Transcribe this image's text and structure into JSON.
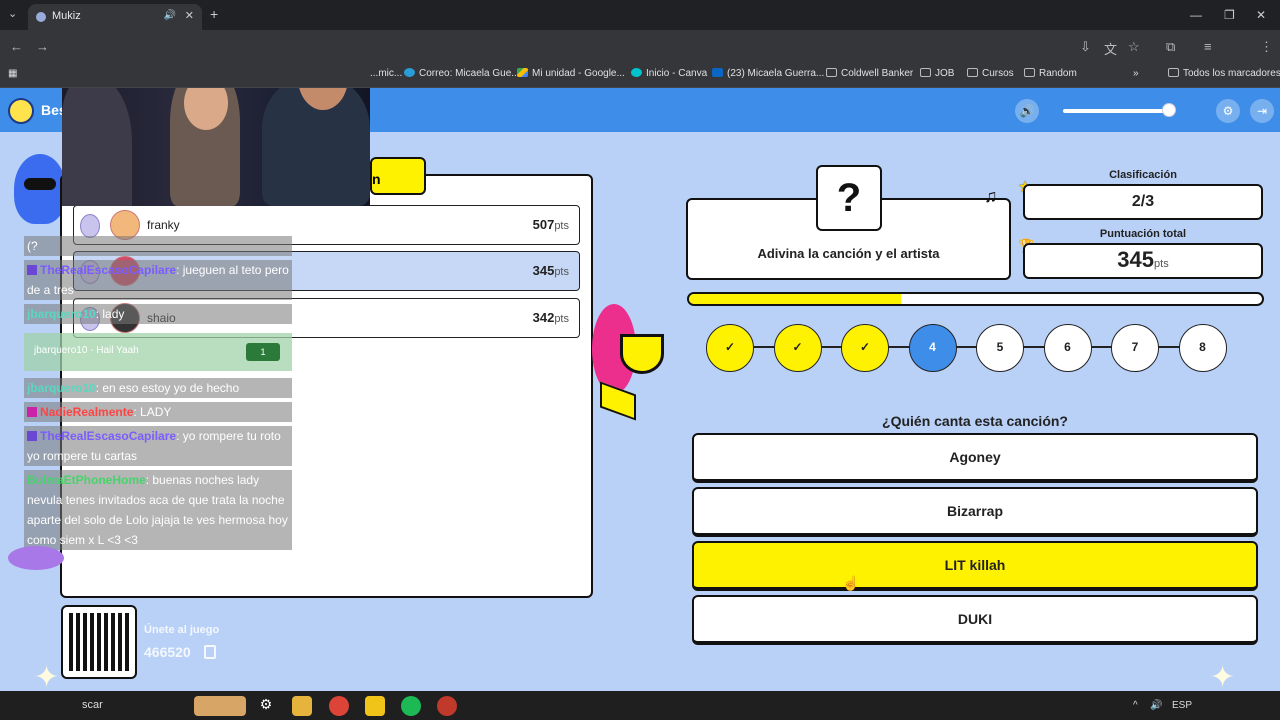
{
  "browser": {
    "tab_title": "Mukiz",
    "new_tab_label": "+",
    "bookmarks": [
      {
        "label": "...mic...",
        "icon": "folder-icon"
      },
      {
        "label": "Correo: Micaela Gue...",
        "icon": "outlook-icon"
      },
      {
        "label": "Mi unidad - Google...",
        "icon": "drive-icon"
      },
      {
        "label": "Inicio - Canva",
        "icon": "canva-icon"
      },
      {
        "label": "(23) Micaela Guerra...",
        "icon": "linkedin-icon"
      },
      {
        "label": "Coldwell Banker",
        "icon": "folder-icon"
      },
      {
        "label": "JOB",
        "icon": "folder-icon"
      },
      {
        "label": "Cursos",
        "icon": "folder-icon"
      },
      {
        "label": "Random",
        "icon": "folder-icon"
      }
    ],
    "bookmarks_overflow": "»",
    "all_bookmarks": "Todos los marcadores"
  },
  "game": {
    "brand": "Bes",
    "prompt": "Adivina la canción y el artista",
    "mystery_mark": "?",
    "ranking_label": "Clasificación",
    "ranking_value": "2/3",
    "total_label": "Puntuación total",
    "total_value": "345",
    "pts_unit": "pts",
    "progress": 0.37,
    "board_tag": "n",
    "steps": [
      {
        "label": "✓",
        "state": "done"
      },
      {
        "label": "✓",
        "state": "done"
      },
      {
        "label": "✓",
        "state": "done"
      },
      {
        "label": "4",
        "state": "current"
      },
      {
        "label": "5",
        "state": "todo"
      },
      {
        "label": "6",
        "state": "todo"
      },
      {
        "label": "7",
        "state": "todo"
      },
      {
        "label": "8",
        "state": "todo"
      }
    ],
    "question": "¿Quién canta esta canción?",
    "options": [
      "Agoney",
      "Bizarrap",
      "LIT killah",
      "DUKI"
    ],
    "selected_option": 2,
    "leaderboard": [
      {
        "name": "franky",
        "points": "507",
        "unit": "pts"
      },
      {
        "name": "",
        "points": "345",
        "unit": "pts"
      },
      {
        "name": "shaio",
        "points": "342",
        "unit": "pts"
      }
    ],
    "join_label": "Únete al juego",
    "join_code": "466520"
  },
  "chat": {
    "lines": [
      {
        "user": "",
        "text": "(?"
      },
      {
        "user": "TheRealEscasoCapilare",
        "text": ": jueguen al teto pero de a tres"
      },
      {
        "user": "jbarquero10",
        "text": ": lady"
      },
      {
        "user": "jbarquero10",
        "text": ": en eso estoy yo de hecho"
      },
      {
        "user": "NadieRealmente",
        "text": ": LADY"
      },
      {
        "user": "TheRealEscasoCapilare",
        "text": ": yo rompere tu roto yo rompere tu cartas"
      },
      {
        "user": "BulmaEtPhoneHome",
        "text": ": buenas noches lady nevula tenes invitados aca de que trata la noche aparte del solo de Lolo jajaja te ves hermosa hoy como siem x L <3 <3"
      }
    ],
    "highlight": {
      "text": "jbarquero10 - Hail Yaah",
      "bits": "1"
    },
    "colors": {
      "user_purple": "#7b5cff",
      "user_green": "#46d46a",
      "user_red": "#ff4444",
      "user_teal": "#5ad8c0"
    }
  },
  "taskbar": {
    "search_text": "scar",
    "lang": "ESP"
  },
  "colors": {
    "game_bg": "#b9d0f7",
    "header_blue": "#3e8de8",
    "accent_yellow": "#fff200",
    "pink": "#ec2f8d"
  }
}
